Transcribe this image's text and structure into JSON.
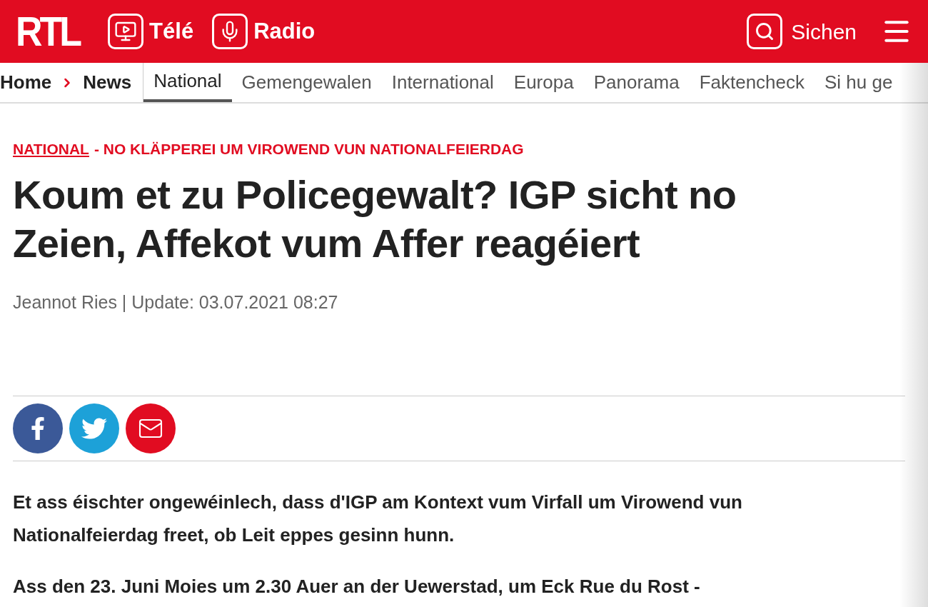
{
  "header": {
    "logo": "RTL",
    "links": [
      {
        "kind": "tv",
        "label": "Télé"
      },
      {
        "kind": "radio",
        "label": "Radio"
      }
    ],
    "search": "Sichen"
  },
  "breadcrumb": [
    "Home",
    "News"
  ],
  "sections": [
    {
      "label": "National",
      "selected": true
    },
    {
      "label": "Gemengewalen",
      "selected": false
    },
    {
      "label": "International",
      "selected": false
    },
    {
      "label": "Europa",
      "selected": false
    },
    {
      "label": "Panorama",
      "selected": false
    },
    {
      "label": "Faktencheck",
      "selected": false
    },
    {
      "label": "Si hu ge",
      "selected": false
    }
  ],
  "article": {
    "category": "NATIONAL",
    "topic": "- NO KLÄPPEREI UM VIROWEND VUN NATIONALFEIERDAG",
    "headline": "Koum et zu Policegewalt? IGP sicht no Zeien, Affekot vum Affer reagéiert",
    "byline": "Jeannot Ries | Update: 03.07.2021 08:27",
    "share": [
      {
        "kind": "facebook"
      },
      {
        "kind": "twitter"
      },
      {
        "kind": "email"
      }
    ],
    "paragraphs": [
      "Et ass éischter ongewéinlech, dass d'IGP am Kontext vum Virfall um Virowend vun Nationalfeierdag freet, ob Leit eppes gesinn hunn.",
      "Ass den 23. Juni Moies um 2.30 Auer an der Uewerstad, um Eck Rue du Rost -"
    ]
  }
}
